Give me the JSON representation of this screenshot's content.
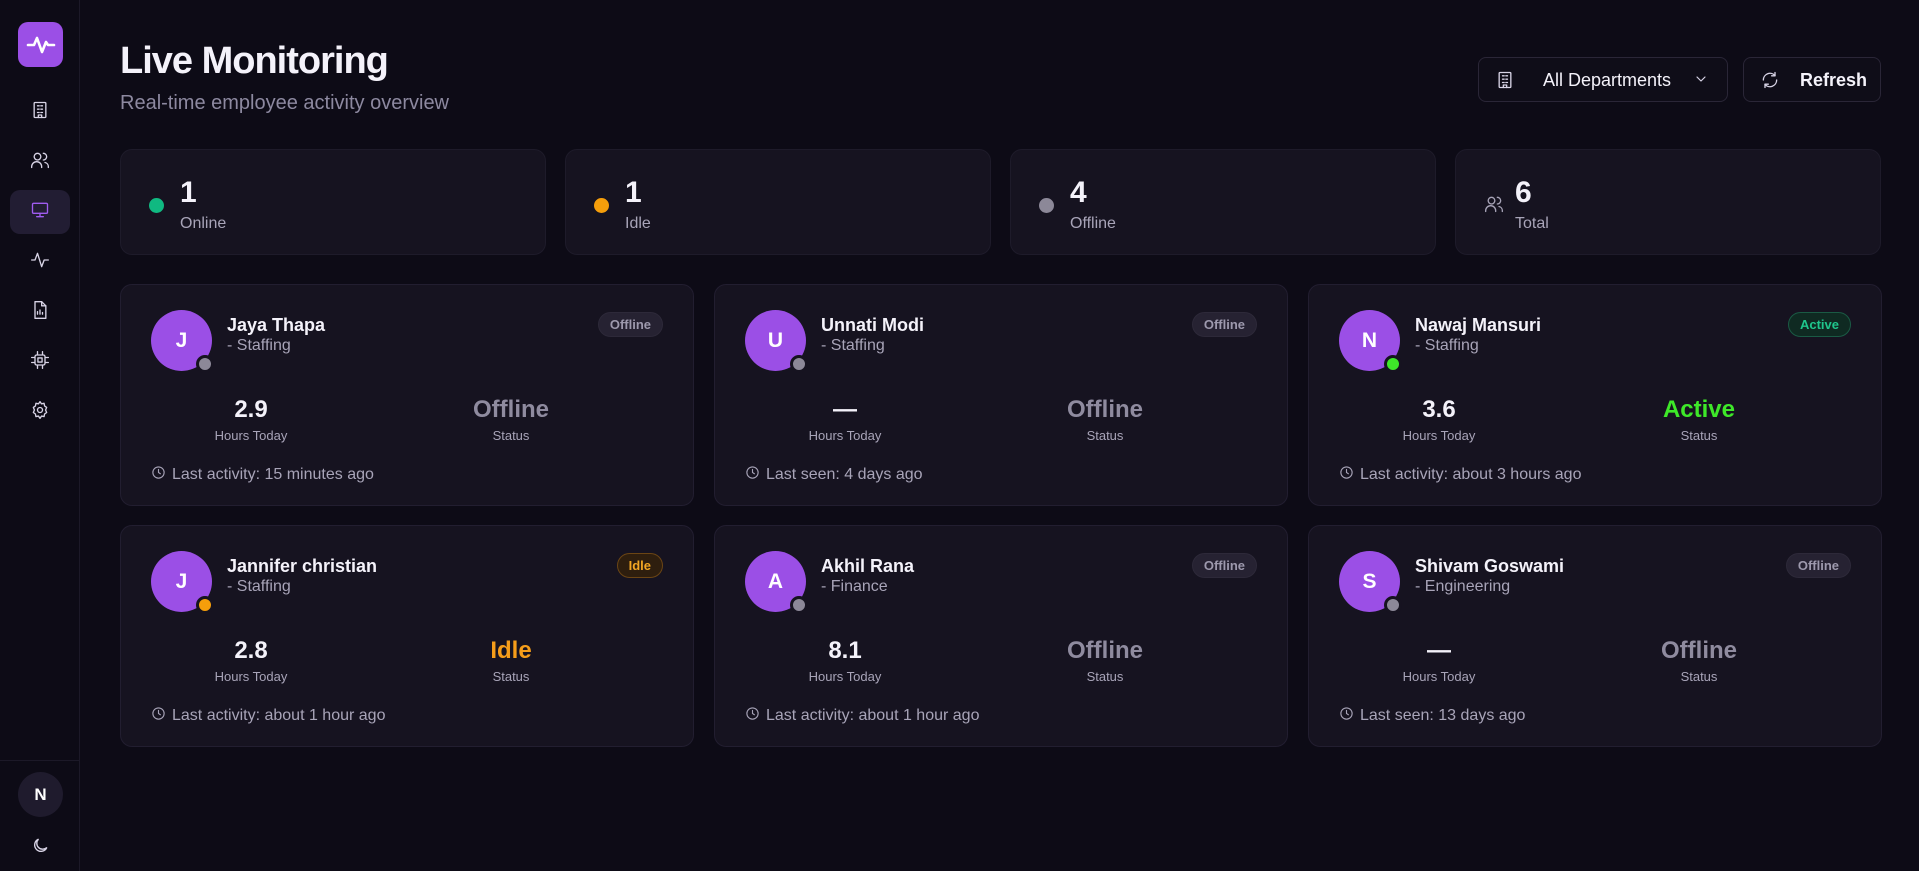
{
  "sidebar": {
    "logo_icon": "activity-pulse-icon",
    "items": [
      {
        "icon": "building-icon",
        "active": false
      },
      {
        "icon": "users-icon",
        "active": false
      },
      {
        "icon": "monitor-icon",
        "active": true
      },
      {
        "icon": "activity-icon",
        "active": false
      },
      {
        "icon": "report-icon",
        "active": false
      },
      {
        "icon": "chip-icon",
        "active": false
      },
      {
        "icon": "settings-icon",
        "active": false
      }
    ],
    "user_initial": "N",
    "theme_icon": "moon-icon"
  },
  "header": {
    "title": "Live Monitoring",
    "subtitle": "Real-time employee activity overview",
    "department_select": "All Departments",
    "refresh_label": "Refresh"
  },
  "stats": [
    {
      "value": "1",
      "label": "Online",
      "color": "#10b981"
    },
    {
      "value": "1",
      "label": "Idle",
      "color": "#f59e0b"
    },
    {
      "value": "4",
      "label": "Offline",
      "color": "#8c8898"
    },
    {
      "value": "6",
      "label": "Total",
      "icon": "users-icon"
    }
  ],
  "employees": [
    {
      "initial": "J",
      "name": "Jaya Thapa",
      "dept": "- Staffing",
      "badge": "Offline",
      "hours": "2.9",
      "hours_label": "Hours Today",
      "status": "Offline",
      "status_label": "Status",
      "last": "Last activity: 15 minutes ago",
      "presence_color": "#8c8898"
    },
    {
      "initial": "U",
      "name": "Unnati Modi",
      "dept": "- Staffing",
      "badge": "Offline",
      "hours": "—",
      "hours_label": "Hours Today",
      "status": "Offline",
      "status_label": "Status",
      "last": "Last seen: 4 days ago",
      "presence_color": "#8c8898"
    },
    {
      "initial": "N",
      "name": "Nawaj Mansuri",
      "dept": "- Staffing",
      "badge": "Active",
      "hours": "3.6",
      "hours_label": "Hours Today",
      "status": "Active",
      "status_label": "Status",
      "last": "Last activity: about 3 hours ago",
      "presence_color": "#3ee829"
    },
    {
      "initial": "J",
      "name": "Jannifer christian",
      "dept": "- Staffing",
      "badge": "Idle",
      "hours": "2.8",
      "hours_label": "Hours Today",
      "status": "Idle",
      "status_label": "Status",
      "last": "Last activity: about 1 hour ago",
      "presence_color": "#f59e0b"
    },
    {
      "initial": "A",
      "name": "Akhil Rana",
      "dept": "- Finance",
      "badge": "Offline",
      "hours": "8.1",
      "hours_label": "Hours Today",
      "status": "Offline",
      "status_label": "Status",
      "last": "Last activity: about 1 hour ago",
      "presence_color": "#8c8898"
    },
    {
      "initial": "S",
      "name": "Shivam Goswami",
      "dept": "- Engineering",
      "badge": "Offline",
      "hours": "—",
      "hours_label": "Hours Today",
      "status": "Offline",
      "status_label": "Status",
      "last": "Last seen: 13 days ago",
      "presence_color": "#8c8898"
    }
  ]
}
